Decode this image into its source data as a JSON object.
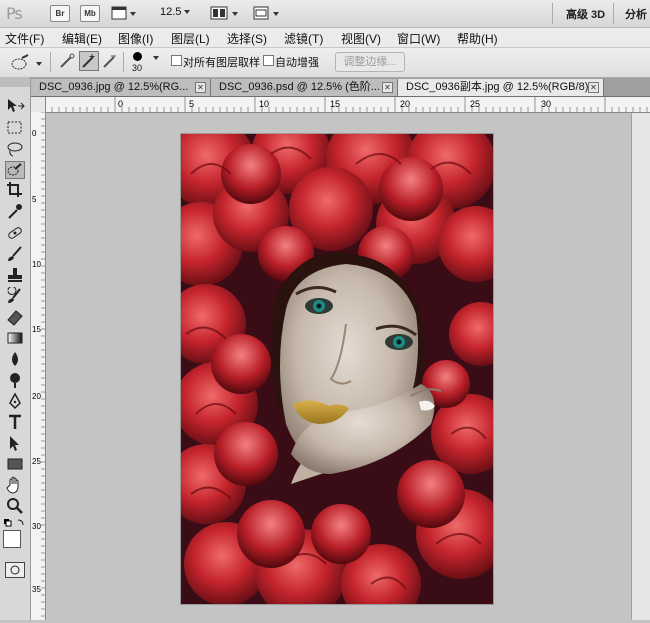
{
  "app": {
    "logo": "Ps",
    "bridge_label": "Br",
    "minibridge_label": "Mb",
    "zoom": "12.5",
    "workspace_primary": "高级 3D",
    "workspace_secondary": "分析"
  },
  "menu": [
    "文件(F)",
    "编辑(E)",
    "图像(I)",
    "图层(L)",
    "选择(S)",
    "滤镜(T)",
    "视图(V)",
    "窗口(W)",
    "帮助(H)"
  ],
  "options": {
    "brush_size": "30",
    "sample_all_label": "对所有图层取样",
    "auto_enhance_label": "自动增强",
    "refine_edge_label": "调整边缘..."
  },
  "tabs": [
    {
      "label": "DSC_0936.jpg @ 12.5%(RG..."
    },
    {
      "label": "DSC_0936.psd @ 12.5% (色阶..."
    },
    {
      "label": "DSC_0936副本.jpg @ 12.5%(RGB/8)",
      "active": true
    }
  ],
  "ruler": {
    "h_labels": [
      "5",
      "0",
      "5",
      "10",
      "15",
      "20",
      "25",
      "30"
    ],
    "v_labels": [
      "0",
      "5",
      "10",
      "15",
      "20",
      "25",
      "30",
      "35"
    ]
  },
  "colors": {
    "accent": "#3a6fc4",
    "canvas": "#c4c4c4"
  },
  "icons": [
    "move-icon",
    "marquee-icon",
    "lasso-icon",
    "quick-select-icon",
    "crop-icon",
    "eyedropper-icon",
    "spot-heal-icon",
    "brush-icon",
    "clone-stamp-icon",
    "history-brush-icon",
    "eraser-icon",
    "gradient-icon",
    "blur-icon",
    "dodge-icon",
    "pen-icon",
    "type-icon",
    "path-select-icon",
    "shape-icon",
    "hand-icon",
    "zoom-icon"
  ]
}
